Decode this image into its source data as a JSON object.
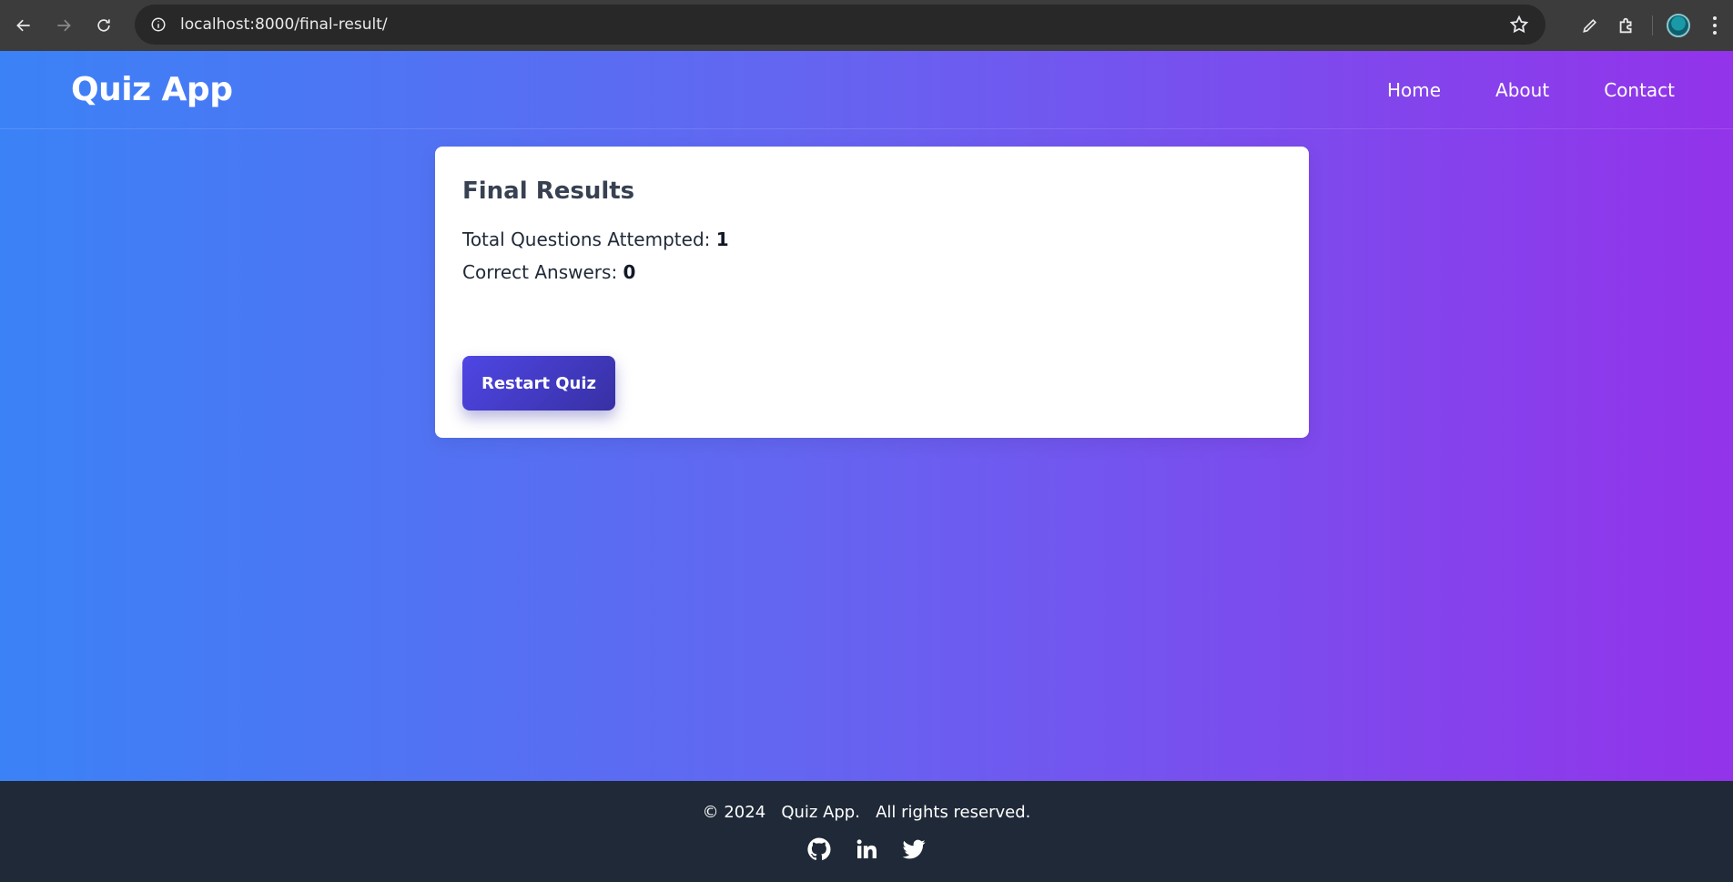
{
  "browser": {
    "url": "localhost:8000/final-result/"
  },
  "header": {
    "brand": "Quiz App",
    "nav": [
      "Home",
      "About",
      "Contact"
    ]
  },
  "results": {
    "title": "Final Results",
    "attempted_label": "Total Questions Attempted: ",
    "attempted_value": "1",
    "correct_label": "Correct Answers: ",
    "correct_value": "0",
    "restart_label": "Restart Quiz"
  },
  "footer": {
    "copyright": "© 2024   Quiz App.   All rights reserved.",
    "social_icons": [
      "github-icon",
      "linkedin-icon",
      "twitter-icon"
    ]
  },
  "colors": {
    "gradient_start": "#3b82f6",
    "gradient_end": "#9333ea",
    "button": "#4f46e5",
    "footer_bg": "#1f2937"
  }
}
